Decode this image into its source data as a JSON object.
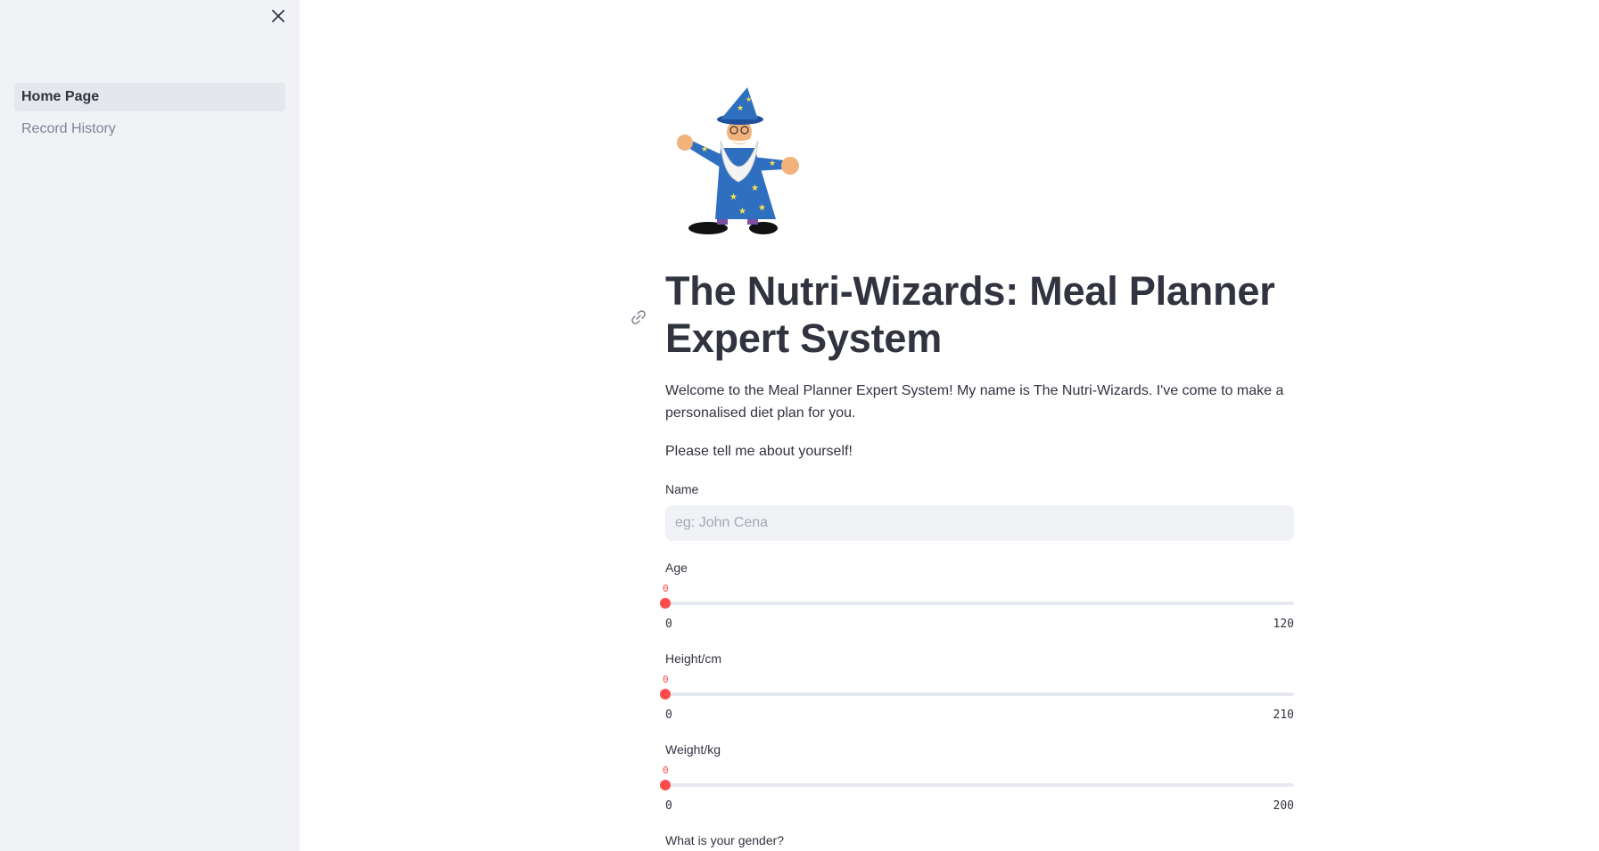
{
  "sidebar": {
    "items": [
      {
        "label": "Home Page",
        "active": true
      },
      {
        "label": "Record History",
        "active": false
      }
    ]
  },
  "main": {
    "title": "The Nutri-Wizards: Meal Planner Expert System",
    "intro": "Welcome to the Meal Planner Expert System! My name is The Nutri-Wizards. I've come to make a personalised diet plan for you.",
    "prompt": "Please tell me about yourself!",
    "name_field": {
      "label": "Name",
      "placeholder": "eg: John Cena",
      "value": ""
    },
    "age_slider": {
      "label": "Age",
      "value": "0",
      "min": "0",
      "max": "120"
    },
    "height_slider": {
      "label": "Height/cm",
      "value": "0",
      "min": "0",
      "max": "210"
    },
    "weight_slider": {
      "label": "Weight/kg",
      "value": "0",
      "min": "0",
      "max": "200"
    },
    "gender_question": "What is your gender?"
  },
  "colors": {
    "accent": "#ff4b4b",
    "sidebar_bg": "#f0f2f6",
    "text": "#31333f"
  },
  "icons": {
    "close": "close-icon",
    "link": "link-icon"
  }
}
